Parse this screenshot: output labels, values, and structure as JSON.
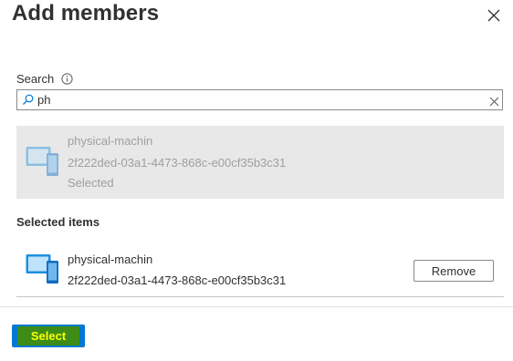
{
  "panel": {
    "title": "Add members",
    "close_icon": "close-icon"
  },
  "search": {
    "label": "Search",
    "info_icon": "info-icon",
    "value": "ph",
    "search_icon": "search-icon",
    "clear_icon": "clear-icon"
  },
  "results": [
    {
      "name": "physical-machin",
      "id": "2f222ded-03a1-4473-868c-e00cf35b3c31",
      "status": "Selected",
      "icon": "device-icon"
    }
  ],
  "selected_items": {
    "heading": "Selected items",
    "items": [
      {
        "name": "physical-machin",
        "id": "2f222ded-03a1-4473-868c-e00cf35b3c31",
        "remove_label": "Remove",
        "icon": "device-icon"
      }
    ]
  },
  "footer": {
    "select_label": "Select"
  },
  "colors": {
    "primary": "#0078d4",
    "highlight_bg": "#3c8c17",
    "highlight_text": "#ffff00",
    "result_bg": "#e8e8e8"
  }
}
